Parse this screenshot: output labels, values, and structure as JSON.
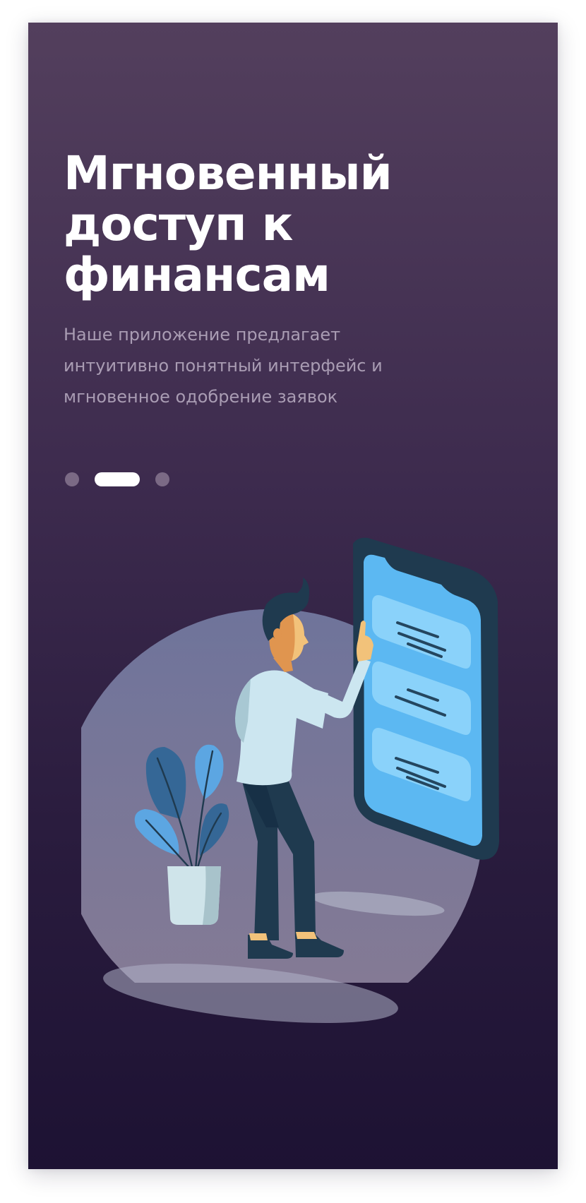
{
  "onboarding": {
    "title_lines": [
      "Мгновенный",
      "доступ к",
      "финансам"
    ],
    "subtitle_lines": [
      "Наше приложение предлагает",
      "интуитивно понятный интерфейс и",
      "мгновенное одобрение заявок"
    ],
    "pager": {
      "total": 3,
      "active_index": 1
    },
    "illustration": {
      "subject": "man-touching-giant-phone",
      "icons": [
        "person-icon",
        "phone-icon",
        "plant-icon"
      ]
    }
  },
  "colors": {
    "background_top": "#533f5d",
    "background_bottom": "#1d1233",
    "title": "#ffffff",
    "subtitle": "#a99cb3",
    "dot_inactive": "#7b6a85",
    "dot_active": "#ffffff",
    "phone_frame": "#1f3a4f",
    "phone_screen": "#5cb8f2",
    "phone_card": "#8ad2fa"
  }
}
